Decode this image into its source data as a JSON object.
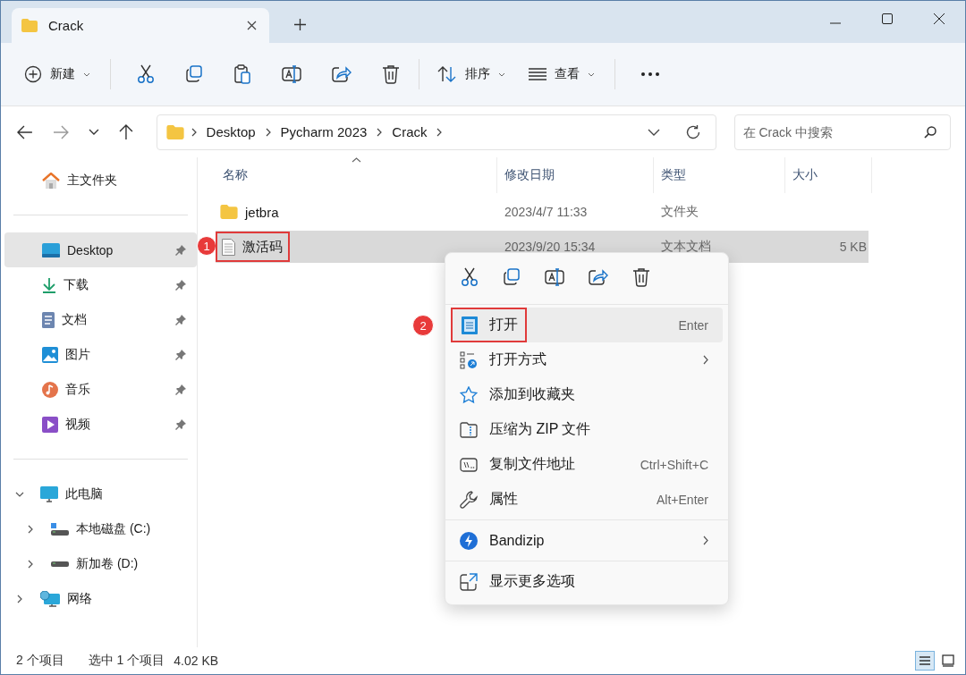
{
  "window": {
    "tab": {
      "title": "Crack"
    }
  },
  "toolbar": {
    "new": {
      "label": "新建"
    },
    "sort": {
      "label": "排序"
    },
    "view": {
      "label": "查看"
    }
  },
  "address": {
    "path": [
      "Desktop",
      "Pycharm 2023",
      "Crack"
    ]
  },
  "search": {
    "placeholder": "在 Crack 中搜索"
  },
  "sidebar": {
    "home": {
      "label": "主文件夹"
    },
    "quick": [
      {
        "label": "Desktop",
        "pinned": true,
        "selected": true
      },
      {
        "label": "下载",
        "pinned": true,
        "selected": false
      },
      {
        "label": "文档",
        "pinned": true,
        "selected": false
      },
      {
        "label": "图片",
        "pinned": true,
        "selected": false
      },
      {
        "label": "音乐",
        "pinned": true,
        "selected": false
      },
      {
        "label": "视频",
        "pinned": true,
        "selected": false
      }
    ],
    "tree": [
      {
        "label": "此电脑",
        "expanded": true,
        "children": [
          {
            "label": "本地磁盘 (C:)",
            "expanded": false
          },
          {
            "label": "新加卷 (D:)",
            "expanded": false
          }
        ]
      },
      {
        "label": "网络",
        "expanded": false
      }
    ]
  },
  "table": {
    "columns": [
      {
        "label": "名称",
        "sorted": true
      },
      {
        "label": "修改日期",
        "sorted": false
      },
      {
        "label": "类型",
        "sorted": false
      },
      {
        "label": "大小",
        "sorted": false
      }
    ],
    "rows": [
      {
        "kind": "folder",
        "name": "jetbra",
        "date": "2023/4/7 11:33",
        "type": "文件夹",
        "selected": false
      },
      {
        "kind": "text",
        "name": "激活码",
        "date": "2023/9/20 15:34",
        "type": "文本文档",
        "size": "5 KB",
        "selected": true,
        "callout": "1"
      }
    ]
  },
  "context_menu": {
    "items": [
      {
        "kind": "item",
        "label": "打开",
        "shortcut": "Enter",
        "highlighted": true,
        "callout": "2"
      },
      {
        "kind": "item",
        "label": "打开方式",
        "submenu": true,
        "highlighted": false
      },
      {
        "kind": "item",
        "label": "添加到收藏夹",
        "highlighted": false
      },
      {
        "kind": "item",
        "label": "压缩为 ZIP 文件",
        "highlighted": false
      },
      {
        "kind": "item",
        "label": "复制文件地址",
        "shortcut": "Ctrl+Shift+C",
        "highlighted": false
      },
      {
        "kind": "item",
        "label": "属性",
        "shortcut": "Alt+Enter",
        "highlighted": false
      },
      {
        "kind": "separator"
      },
      {
        "kind": "item",
        "label": "Bandizip",
        "submenu": true,
        "highlighted": false
      },
      {
        "kind": "separator"
      },
      {
        "kind": "item",
        "label": "显示更多选项",
        "highlighted": false
      }
    ]
  },
  "status_bar": {
    "count": "2 个项目",
    "selection": "选中 1 个项目",
    "size": "4.02 KB",
    "view_modes": [
      {
        "selected": true
      },
      {
        "selected": false
      }
    ]
  }
}
